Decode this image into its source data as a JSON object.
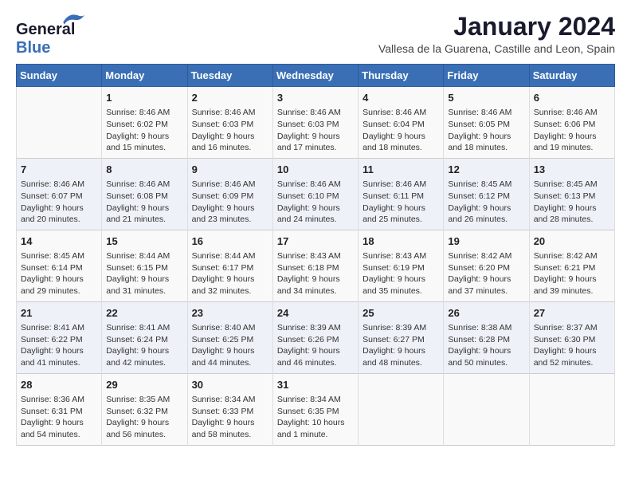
{
  "header": {
    "logo_line1": "General",
    "logo_line2": "Blue",
    "month": "January 2024",
    "location": "Vallesa de la Guarena, Castille and Leon, Spain"
  },
  "days_of_week": [
    "Sunday",
    "Monday",
    "Tuesday",
    "Wednesday",
    "Thursday",
    "Friday",
    "Saturday"
  ],
  "weeks": [
    [
      {
        "num": "",
        "lines": []
      },
      {
        "num": "1",
        "lines": [
          "Sunrise: 8:46 AM",
          "Sunset: 6:02 PM",
          "Daylight: 9 hours",
          "and 15 minutes."
        ]
      },
      {
        "num": "2",
        "lines": [
          "Sunrise: 8:46 AM",
          "Sunset: 6:03 PM",
          "Daylight: 9 hours",
          "and 16 minutes."
        ]
      },
      {
        "num": "3",
        "lines": [
          "Sunrise: 8:46 AM",
          "Sunset: 6:03 PM",
          "Daylight: 9 hours",
          "and 17 minutes."
        ]
      },
      {
        "num": "4",
        "lines": [
          "Sunrise: 8:46 AM",
          "Sunset: 6:04 PM",
          "Daylight: 9 hours",
          "and 18 minutes."
        ]
      },
      {
        "num": "5",
        "lines": [
          "Sunrise: 8:46 AM",
          "Sunset: 6:05 PM",
          "Daylight: 9 hours",
          "and 18 minutes."
        ]
      },
      {
        "num": "6",
        "lines": [
          "Sunrise: 8:46 AM",
          "Sunset: 6:06 PM",
          "Daylight: 9 hours",
          "and 19 minutes."
        ]
      }
    ],
    [
      {
        "num": "7",
        "lines": [
          "Sunrise: 8:46 AM",
          "Sunset: 6:07 PM",
          "Daylight: 9 hours",
          "and 20 minutes."
        ]
      },
      {
        "num": "8",
        "lines": [
          "Sunrise: 8:46 AM",
          "Sunset: 6:08 PM",
          "Daylight: 9 hours",
          "and 21 minutes."
        ]
      },
      {
        "num": "9",
        "lines": [
          "Sunrise: 8:46 AM",
          "Sunset: 6:09 PM",
          "Daylight: 9 hours",
          "and 23 minutes."
        ]
      },
      {
        "num": "10",
        "lines": [
          "Sunrise: 8:46 AM",
          "Sunset: 6:10 PM",
          "Daylight: 9 hours",
          "and 24 minutes."
        ]
      },
      {
        "num": "11",
        "lines": [
          "Sunrise: 8:46 AM",
          "Sunset: 6:11 PM",
          "Daylight: 9 hours",
          "and 25 minutes."
        ]
      },
      {
        "num": "12",
        "lines": [
          "Sunrise: 8:45 AM",
          "Sunset: 6:12 PM",
          "Daylight: 9 hours",
          "and 26 minutes."
        ]
      },
      {
        "num": "13",
        "lines": [
          "Sunrise: 8:45 AM",
          "Sunset: 6:13 PM",
          "Daylight: 9 hours",
          "and 28 minutes."
        ]
      }
    ],
    [
      {
        "num": "14",
        "lines": [
          "Sunrise: 8:45 AM",
          "Sunset: 6:14 PM",
          "Daylight: 9 hours",
          "and 29 minutes."
        ]
      },
      {
        "num": "15",
        "lines": [
          "Sunrise: 8:44 AM",
          "Sunset: 6:15 PM",
          "Daylight: 9 hours",
          "and 31 minutes."
        ]
      },
      {
        "num": "16",
        "lines": [
          "Sunrise: 8:44 AM",
          "Sunset: 6:17 PM",
          "Daylight: 9 hours",
          "and 32 minutes."
        ]
      },
      {
        "num": "17",
        "lines": [
          "Sunrise: 8:43 AM",
          "Sunset: 6:18 PM",
          "Daylight: 9 hours",
          "and 34 minutes."
        ]
      },
      {
        "num": "18",
        "lines": [
          "Sunrise: 8:43 AM",
          "Sunset: 6:19 PM",
          "Daylight: 9 hours",
          "and 35 minutes."
        ]
      },
      {
        "num": "19",
        "lines": [
          "Sunrise: 8:42 AM",
          "Sunset: 6:20 PM",
          "Daylight: 9 hours",
          "and 37 minutes."
        ]
      },
      {
        "num": "20",
        "lines": [
          "Sunrise: 8:42 AM",
          "Sunset: 6:21 PM",
          "Daylight: 9 hours",
          "and 39 minutes."
        ]
      }
    ],
    [
      {
        "num": "21",
        "lines": [
          "Sunrise: 8:41 AM",
          "Sunset: 6:22 PM",
          "Daylight: 9 hours",
          "and 41 minutes."
        ]
      },
      {
        "num": "22",
        "lines": [
          "Sunrise: 8:41 AM",
          "Sunset: 6:24 PM",
          "Daylight: 9 hours",
          "and 42 minutes."
        ]
      },
      {
        "num": "23",
        "lines": [
          "Sunrise: 8:40 AM",
          "Sunset: 6:25 PM",
          "Daylight: 9 hours",
          "and 44 minutes."
        ]
      },
      {
        "num": "24",
        "lines": [
          "Sunrise: 8:39 AM",
          "Sunset: 6:26 PM",
          "Daylight: 9 hours",
          "and 46 minutes."
        ]
      },
      {
        "num": "25",
        "lines": [
          "Sunrise: 8:39 AM",
          "Sunset: 6:27 PM",
          "Daylight: 9 hours",
          "and 48 minutes."
        ]
      },
      {
        "num": "26",
        "lines": [
          "Sunrise: 8:38 AM",
          "Sunset: 6:28 PM",
          "Daylight: 9 hours",
          "and 50 minutes."
        ]
      },
      {
        "num": "27",
        "lines": [
          "Sunrise: 8:37 AM",
          "Sunset: 6:30 PM",
          "Daylight: 9 hours",
          "and 52 minutes."
        ]
      }
    ],
    [
      {
        "num": "28",
        "lines": [
          "Sunrise: 8:36 AM",
          "Sunset: 6:31 PM",
          "Daylight: 9 hours",
          "and 54 minutes."
        ]
      },
      {
        "num": "29",
        "lines": [
          "Sunrise: 8:35 AM",
          "Sunset: 6:32 PM",
          "Daylight: 9 hours",
          "and 56 minutes."
        ]
      },
      {
        "num": "30",
        "lines": [
          "Sunrise: 8:34 AM",
          "Sunset: 6:33 PM",
          "Daylight: 9 hours",
          "and 58 minutes."
        ]
      },
      {
        "num": "31",
        "lines": [
          "Sunrise: 8:34 AM",
          "Sunset: 6:35 PM",
          "Daylight: 10 hours",
          "and 1 minute."
        ]
      },
      {
        "num": "",
        "lines": []
      },
      {
        "num": "",
        "lines": []
      },
      {
        "num": "",
        "lines": []
      }
    ]
  ]
}
